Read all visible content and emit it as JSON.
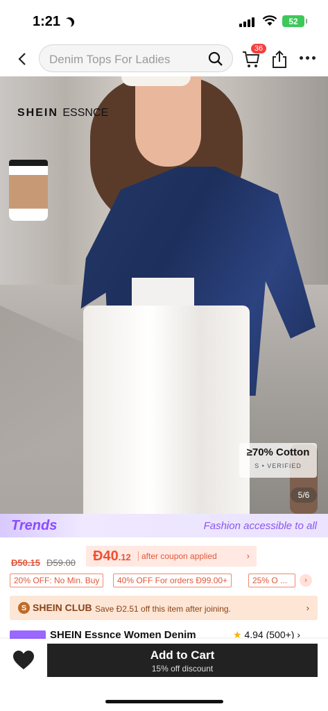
{
  "status": {
    "time": "1:21",
    "battery": "52"
  },
  "header": {
    "search_placeholder": "Denim Tops For Ladies",
    "cart_count": "36"
  },
  "product_image": {
    "brand_main": "SHEIN",
    "brand_sub": "ESSNCE",
    "cotton_badge": "≥70% Cotton",
    "verified": "S • VERIFIED",
    "counter": "5/6"
  },
  "trends": {
    "logo": "Trends",
    "tagline": "Fashion accessible to all"
  },
  "price": {
    "old_price_1": "Đ50.15",
    "old_price_2": "Đ59.00",
    "coupon_amount_main": "Đ40",
    "coupon_amount_cents": ".12",
    "coupon_text": "after coupon applied"
  },
  "promos": [
    "20% OFF: No Min. Buy",
    "40% OFF For orders Đ99.00+",
    "25% O ..."
  ],
  "club": {
    "icon_letter": "S",
    "name": "SHEIN CLUB",
    "description": "Save Đ2.51 off this item after joining."
  },
  "product": {
    "title": "SHEIN Essnce Women Denim",
    "rating": "4.94",
    "review_count": "(500+)"
  },
  "bottom": {
    "add_to_cart": "Add to Cart",
    "discount": "15% off discount"
  },
  "colors": {
    "accent": "#f0502f",
    "trends": "#8a4bff",
    "cta": "#222222"
  }
}
